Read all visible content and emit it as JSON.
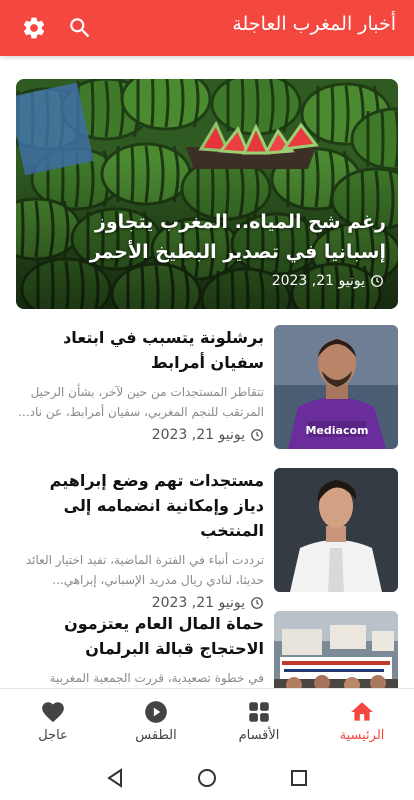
{
  "app": {
    "title": "أخبار المغرب العاجلة"
  },
  "toolbar": {
    "settings_icon": "gear-icon",
    "search_icon": "search-icon"
  },
  "colors": {
    "accent": "#f4473f",
    "text": "#111111",
    "muted": "#8a8a8a"
  },
  "hero": {
    "title": "رغم شح المياه.. المغرب يتجاوز إسبانيا في تصدير البطيخ الأحمر",
    "date": "يونيو 21, 2023"
  },
  "articles": [
    {
      "title": "برشلونة يتسبب في ابتعاد سفيان أمرابط",
      "excerpt": "تتقاطر المستجدات من حين لآخر، بشأن الرحيل المرتقب للنجم المغربي، سفيان أمرابط، عن ناد...",
      "date": "يونيو 21, 2023"
    },
    {
      "title": "مستجدات تهم وضع إبراهيم دياز وإمكانية انضمامه إلى المنتخب",
      "excerpt": "ترددت أنباء في الفترة الماضية، تفيد اختيار العائد حديثا، لنادي ريال مدريد الإسباني، إبراهي...",
      "date": "يونيو 21, 2023"
    },
    {
      "title": "حماة المال العام يعتزمون الاحتجاج قبالة البرلمان",
      "excerpt": "في خطوة تصعيدية، قررت الجمعية المغربية",
      "date": ""
    }
  ],
  "nav": {
    "home": "الرئيسية",
    "sections": "الأقسام",
    "weather": "الطقس",
    "urgent": "عاجل"
  }
}
